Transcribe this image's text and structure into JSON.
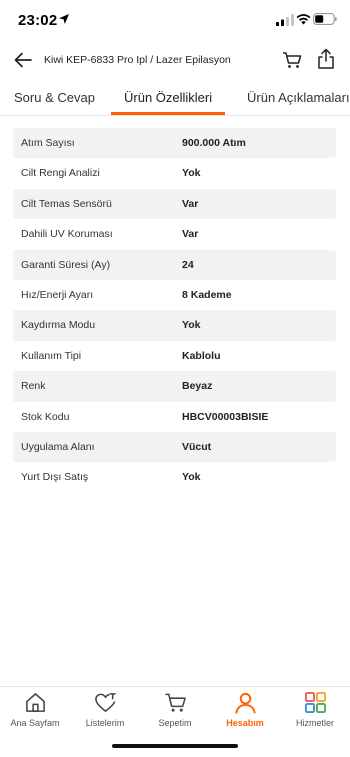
{
  "status_bar": {
    "time": "23:02"
  },
  "header": {
    "title": "Kiwi KEP-6833 Pro Ipl / Lazer Epilasyon"
  },
  "tabs": [
    {
      "label": "Soru & Cevap"
    },
    {
      "label": "Ürün Özellikleri",
      "active": true
    },
    {
      "label": "Ürün Açıklamaları"
    }
  ],
  "specs": [
    {
      "label": "Atım Sayısı",
      "value": "900.000 Atım"
    },
    {
      "label": "Cilt Rengi Analizi",
      "value": "Yok"
    },
    {
      "label": "Cilt Temas Sensörü",
      "value": "Var"
    },
    {
      "label": "Dahili UV Koruması",
      "value": "Var"
    },
    {
      "label": "Garanti Süresi (Ay)",
      "value": "24"
    },
    {
      "label": "Hız/Enerji Ayarı",
      "value": "8 Kademe"
    },
    {
      "label": "Kaydırma Modu",
      "value": "Yok"
    },
    {
      "label": "Kullanım Tipi",
      "value": "Kablolu"
    },
    {
      "label": "Renk",
      "value": "Beyaz"
    },
    {
      "label": "Stok Kodu",
      "value": "HBCV00003BISIE"
    },
    {
      "label": "Uygulama Alanı",
      "value": "Vücut"
    },
    {
      "label": "Yurt Dışı Satış",
      "value": "Yok"
    }
  ],
  "bottom_nav": [
    {
      "label": "Ana Sayfam",
      "icon": "home-icon"
    },
    {
      "label": "Listelerim",
      "icon": "heart-list-icon"
    },
    {
      "label": "Sepetim",
      "icon": "cart-icon"
    },
    {
      "label": "Hesabım",
      "icon": "user-icon",
      "active": true
    },
    {
      "label": "Hizmetler",
      "icon": "services-grid-icon"
    }
  ],
  "colors": {
    "accent": "#ff6000",
    "row_shade": "#f2f2f2"
  }
}
